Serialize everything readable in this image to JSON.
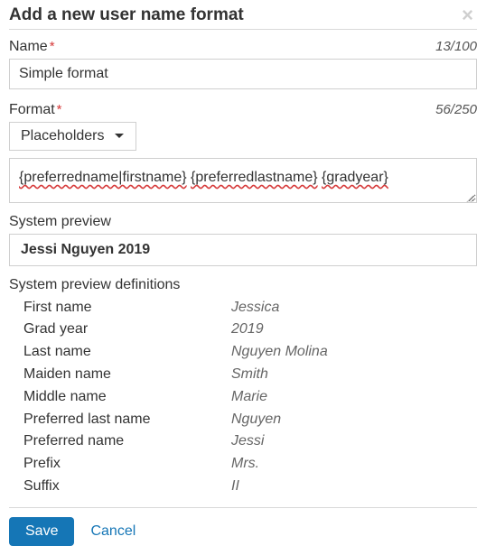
{
  "modal": {
    "title": "Add a new user name format"
  },
  "name": {
    "label": "Name",
    "counter": "13/100",
    "value": "Simple format"
  },
  "format": {
    "label": "Format",
    "counter": "56/250",
    "placeholders_button": "Placeholders",
    "value_tokens": [
      "{preferredname|firstname}",
      "{preferredlastname}",
      "{gradyear}"
    ]
  },
  "preview": {
    "label": "System preview",
    "value": "Jessi Nguyen 2019"
  },
  "definitions": {
    "label": "System preview definitions",
    "rows": [
      {
        "label": "First name",
        "value": "Jessica"
      },
      {
        "label": "Grad year",
        "value": "2019"
      },
      {
        "label": "Last name",
        "value": "Nguyen Molina"
      },
      {
        "label": "Maiden name",
        "value": "Smith"
      },
      {
        "label": "Middle name",
        "value": "Marie"
      },
      {
        "label": "Preferred last name",
        "value": "Nguyen"
      },
      {
        "label": "Preferred name",
        "value": "Jessi"
      },
      {
        "label": "Prefix",
        "value": "Mrs."
      },
      {
        "label": "Suffix",
        "value": "II"
      }
    ]
  },
  "footer": {
    "save": "Save",
    "cancel": "Cancel"
  }
}
